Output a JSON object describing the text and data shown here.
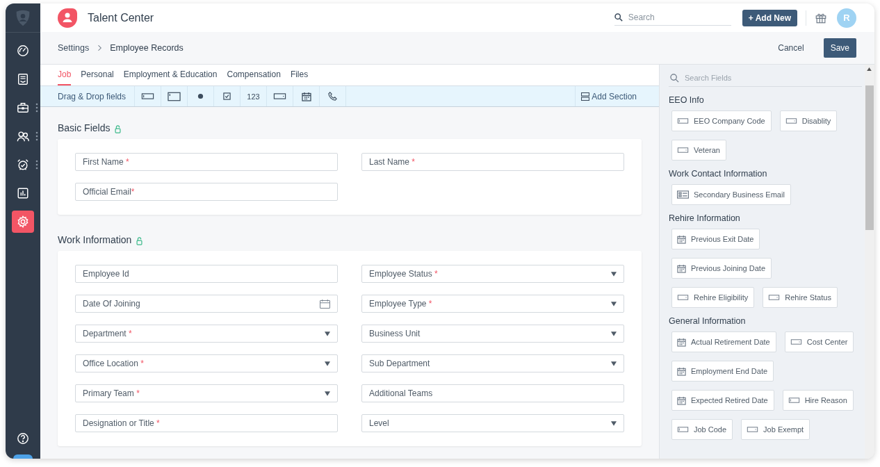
{
  "app": {
    "title": "Talent Center"
  },
  "nav": [
    {
      "selected": false,
      "has_menu": false
    },
    {
      "selected": false,
      "has_menu": false
    },
    {
      "selected": false,
      "has_menu": true
    },
    {
      "selected": false,
      "has_menu": true
    },
    {
      "selected": false,
      "has_menu": true
    },
    {
      "selected": false,
      "has_menu": false
    },
    {
      "selected": true,
      "has_menu": false
    }
  ],
  "header": {
    "search": {
      "placeholder": "Search"
    },
    "add_button": "+ Add New",
    "avatar": "R"
  },
  "breadcrumb": [
    "Settings",
    "Employee Records"
  ],
  "actions": {
    "cancel": "Cancel",
    "save": "Save"
  },
  "tabs": [
    {
      "label": "Job",
      "selected": true
    },
    {
      "label": "Personal",
      "selected": false
    },
    {
      "label": "Employment & Education",
      "selected": false
    },
    {
      "label": "Compensation",
      "selected": false
    },
    {
      "label": "Files",
      "selected": false
    }
  ],
  "toolbar": {
    "label": "Drag & Drop fields",
    "tools": [
      {
        "kind": "text"
      },
      {
        "kind": "textarea"
      },
      {
        "kind": "radio"
      },
      {
        "kind": "checkbox"
      },
      {
        "kind": "number",
        "label": "123"
      },
      {
        "kind": "dropdown"
      },
      {
        "kind": "date"
      },
      {
        "kind": "phone"
      }
    ],
    "add_section": "Add Section"
  },
  "sections": [
    {
      "title": "Basic Fields",
      "fields": [
        {
          "label": "First Name",
          "mark": " *",
          "kind": "text"
        },
        {
          "label": "Last Name",
          "mark": " *",
          "kind": "text"
        },
        {
          "label": "Official Email",
          "mark": "*",
          "kind": "text"
        }
      ]
    },
    {
      "title": "Work Information",
      "fields": [
        {
          "label": "Employee Id",
          "kind": "text"
        },
        {
          "label": "Employee Status",
          "mark": " *",
          "kind": "select"
        },
        {
          "label": "Date Of Joining",
          "kind": "date"
        },
        {
          "label": "Employee Type",
          "mark": " *",
          "kind": "select"
        },
        {
          "label": "Department",
          "mark": " *",
          "kind": "select"
        },
        {
          "label": "Business Unit",
          "kind": "select"
        },
        {
          "label": "Office Location",
          "mark": " *",
          "kind": "select"
        },
        {
          "label": "Sub Department",
          "kind": "select"
        },
        {
          "label": "Primary Team",
          "mark": " *",
          "kind": "select"
        },
        {
          "label": "Additional Teams",
          "kind": "text"
        },
        {
          "label": "Designation or Title",
          "mark": " *",
          "kind": "text"
        },
        {
          "label": "Level",
          "kind": "select"
        }
      ]
    }
  ],
  "palette": {
    "search": {
      "placeholder": "Search Fields"
    },
    "groups": [
      {
        "title": "EEO Info",
        "items": [
          {
            "label": "EEO Company Code",
            "kind": "text"
          },
          {
            "label": "Disablity",
            "kind": "dropdown"
          },
          {
            "label": "Veteran",
            "kind": "dropdown"
          }
        ]
      },
      {
        "title": "Work Contact Information",
        "items": [
          {
            "label": "Secondary Business Email",
            "kind": "email"
          }
        ]
      },
      {
        "title": "Rehire Information",
        "items": [
          {
            "label": "Previous Exit Date",
            "kind": "date"
          },
          {
            "label": "Previous Joining Date",
            "kind": "date"
          },
          {
            "label": "Rehire Eligibility",
            "kind": "dropdown"
          },
          {
            "label": "Rehire Status",
            "kind": "dropdown"
          }
        ]
      },
      {
        "title": "General Information",
        "items": [
          {
            "label": "Actual Retirement Date",
            "kind": "date"
          },
          {
            "label": "Cost Center",
            "kind": "dropdown"
          },
          {
            "label": "Employment End Date",
            "kind": "date"
          },
          {
            "label": "Expected Retired Date",
            "kind": "date"
          },
          {
            "label": "Hire Reason",
            "kind": "text"
          },
          {
            "label": "Job Code",
            "kind": "text"
          },
          {
            "label": "Job Exempt",
            "kind": "dropdown"
          }
        ]
      }
    ]
  }
}
